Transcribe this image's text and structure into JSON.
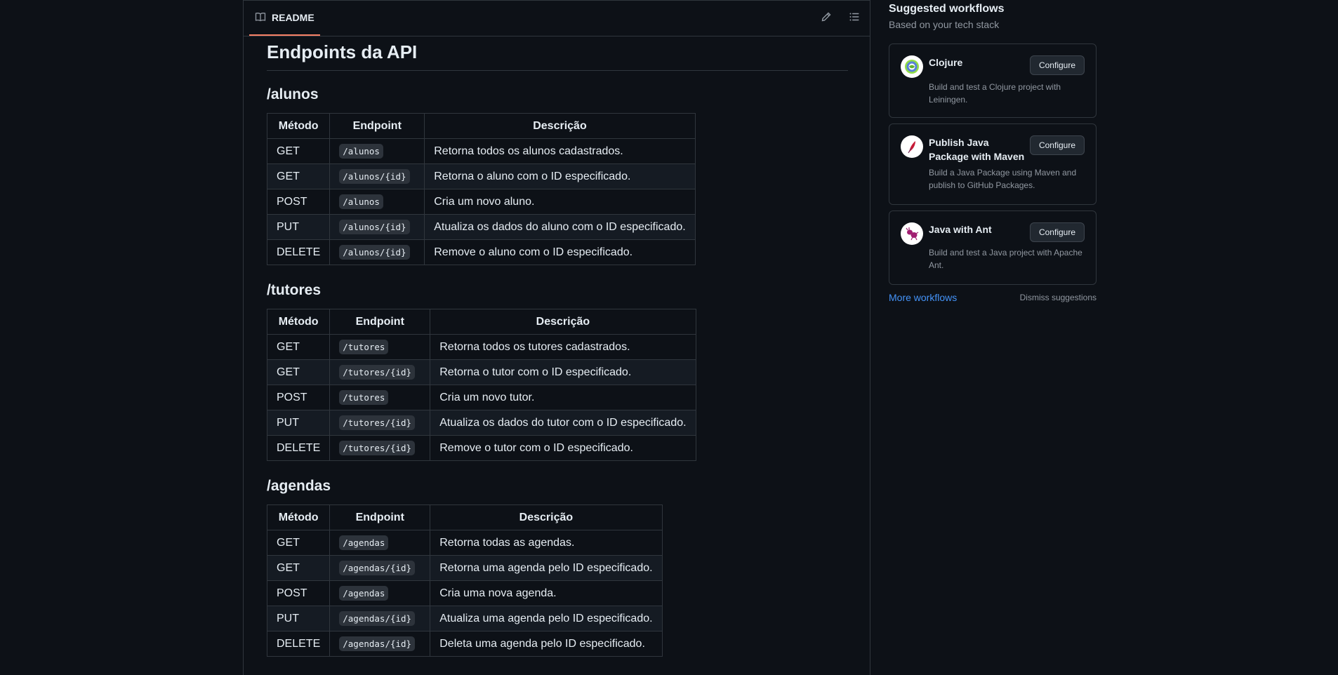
{
  "readme": {
    "tab_label": "README",
    "title": "Endpoints da API"
  },
  "sections": [
    {
      "heading": "/alunos",
      "columns": [
        "Método",
        "Endpoint",
        "Descrição"
      ],
      "rows": [
        {
          "method": "GET",
          "endpoint": "/alunos",
          "description": "Retorna todos os alunos cadastrados."
        },
        {
          "method": "GET",
          "endpoint": "/alunos/{id}",
          "description": "Retorna o aluno com o ID especificado."
        },
        {
          "method": "POST",
          "endpoint": "/alunos",
          "description": "Cria um novo aluno."
        },
        {
          "method": "PUT",
          "endpoint": "/alunos/{id}",
          "description": "Atualiza os dados do aluno com o ID especificado."
        },
        {
          "method": "DELETE",
          "endpoint": "/alunos/{id}",
          "description": "Remove o aluno com o ID especificado."
        }
      ]
    },
    {
      "heading": "/tutores",
      "columns": [
        "Método",
        "Endpoint",
        "Descrição"
      ],
      "rows": [
        {
          "method": "GET",
          "endpoint": "/tutores",
          "description": "Retorna todos os tutores cadastrados."
        },
        {
          "method": "GET",
          "endpoint": "/tutores/{id}",
          "description": "Retorna o tutor com o ID especificado."
        },
        {
          "method": "POST",
          "endpoint": "/tutores",
          "description": "Cria um novo tutor."
        },
        {
          "method": "PUT",
          "endpoint": "/tutores/{id}",
          "description": "Atualiza os dados do tutor com o ID especificado."
        },
        {
          "method": "DELETE",
          "endpoint": "/tutores/{id}",
          "description": "Remove o tutor com o ID especificado."
        }
      ]
    },
    {
      "heading": "/agendas",
      "columns": [
        "Método",
        "Endpoint",
        "Descrição"
      ],
      "rows": [
        {
          "method": "GET",
          "endpoint": "/agendas",
          "description": "Retorna todas as agendas."
        },
        {
          "method": "GET",
          "endpoint": "/agendas/{id}",
          "description": "Retorna uma agenda pelo ID especificado."
        },
        {
          "method": "POST",
          "endpoint": "/agendas",
          "description": "Cria uma nova agenda."
        },
        {
          "method": "PUT",
          "endpoint": "/agendas/{id}",
          "description": "Atualiza uma agenda pelo ID especificado."
        },
        {
          "method": "DELETE",
          "endpoint": "/agendas/{id}",
          "description": "Deleta uma agenda pelo ID especificado."
        }
      ]
    }
  ],
  "sidebar": {
    "title": "Suggested workflows",
    "subtitle": "Based on your tech stack",
    "workflows": [
      {
        "name": "Clojure",
        "description": "Build and test a Clojure project with Leiningen.",
        "button": "Configure",
        "icon": "clojure-logo-icon"
      },
      {
        "name": "Publish Java Package with Maven",
        "description": "Build a Java Package using Maven and publish to GitHub Packages.",
        "button": "Configure",
        "icon": "maven-feather-icon"
      },
      {
        "name": "Java with Ant",
        "description": "Build and test a Java project with Apache Ant.",
        "button": "Configure",
        "icon": "ant-logo-icon"
      }
    ],
    "more_link": "More workflows",
    "dismiss": "Dismiss suggestions"
  },
  "colors": {
    "background": "#0d1117",
    "border": "#30363d",
    "tab_underline": "#f78166",
    "link": "#4493f8",
    "muted_text": "#9198a1"
  }
}
